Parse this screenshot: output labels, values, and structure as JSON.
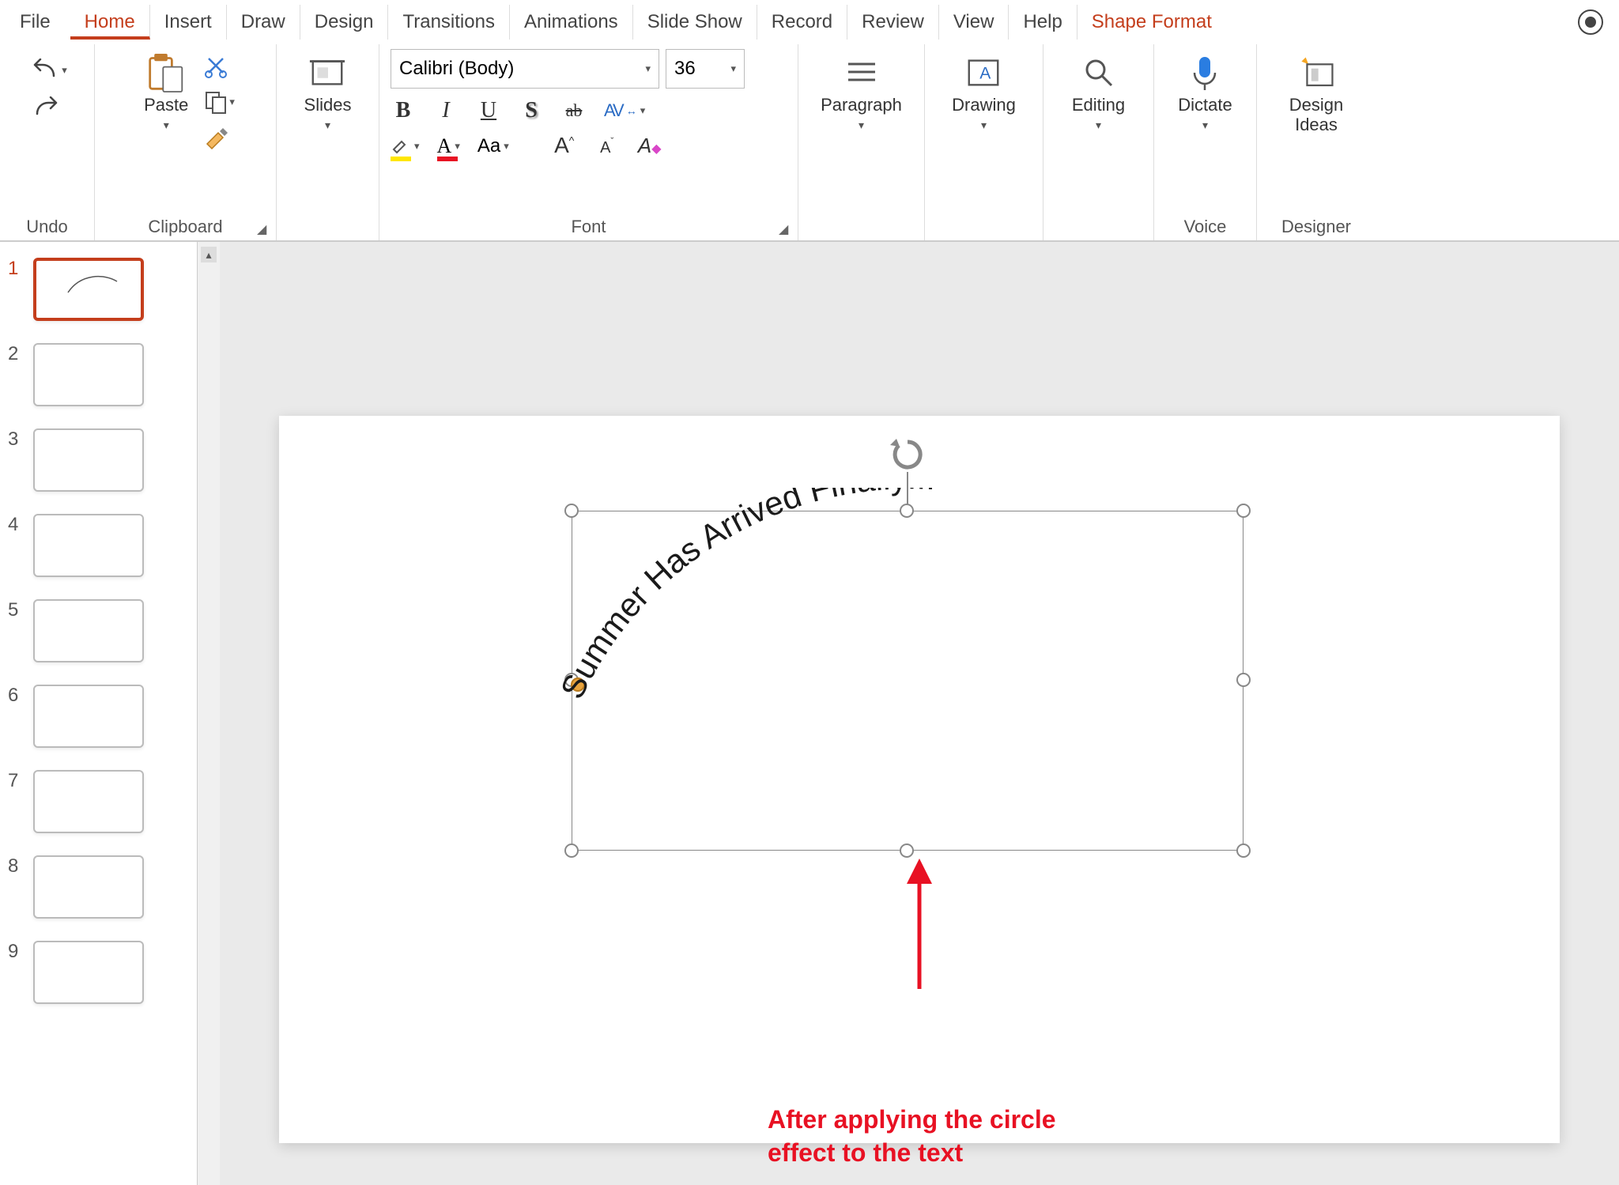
{
  "menu": {
    "items": [
      "File",
      "Home",
      "Insert",
      "Draw",
      "Design",
      "Transitions",
      "Animations",
      "Slide Show",
      "Record",
      "Review",
      "View",
      "Help",
      "Shape Format"
    ],
    "active": "Home",
    "contextual": "Shape Format"
  },
  "ribbon": {
    "undo": {
      "label": "Undo"
    },
    "clipboard": {
      "paste": "Paste",
      "label": "Clipboard"
    },
    "slides": {
      "btn": "Slides"
    },
    "font": {
      "name": "Calibri (Body)",
      "size": "36",
      "label": "Font",
      "bold": "B",
      "italic": "I",
      "underline": "U",
      "shadow": "S",
      "strike": "ab",
      "spacing": "AV",
      "case": "Aa",
      "grow": "A",
      "shrink": "A",
      "clear": "A"
    },
    "paragraph": {
      "label": "Paragraph"
    },
    "drawing": {
      "label": "Drawing"
    },
    "editing": {
      "label": "Editing"
    },
    "voice": {
      "btn": "Dictate",
      "label": "Voice"
    },
    "designer": {
      "btn": "Design Ideas",
      "label": "Designer"
    }
  },
  "thumbnails": {
    "count": 9,
    "active": 1,
    "nums": [
      "1",
      "2",
      "3",
      "4",
      "5",
      "6",
      "7",
      "8",
      "9"
    ]
  },
  "slide": {
    "text": "Summer Has Arrived Finally!!!"
  },
  "annotation": {
    "line1": "After applying the circle",
    "line2": "effect to the text"
  }
}
